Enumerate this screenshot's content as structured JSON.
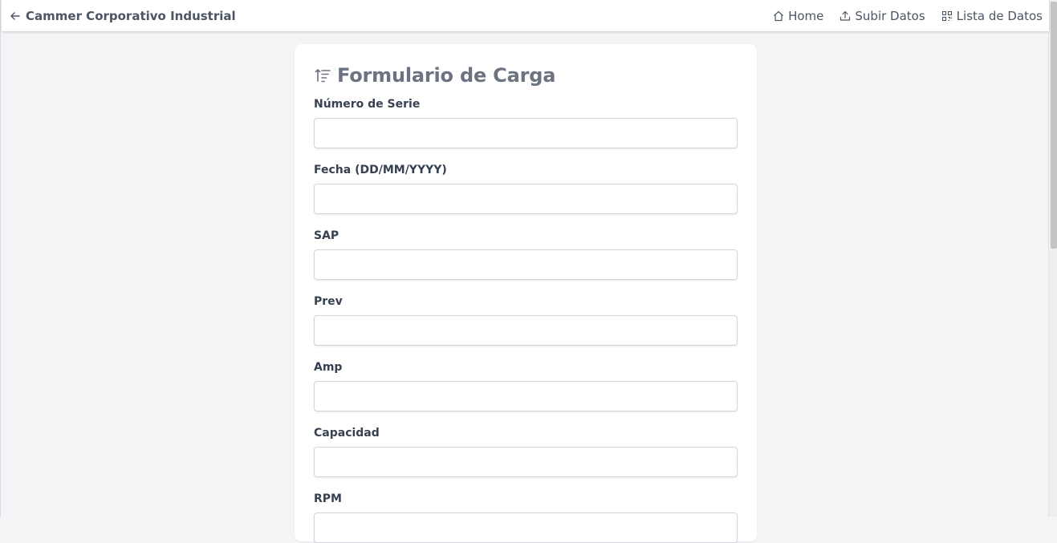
{
  "brand": {
    "icon": "arrow-left-icon",
    "title": "Cammer Corporativo Industrial"
  },
  "nav": {
    "home": {
      "icon": "home-icon",
      "label": "Home"
    },
    "upload": {
      "icon": "upload-icon",
      "label": "Subir Datos"
    },
    "list": {
      "icon": "qr-grid-icon",
      "label": "Lista de Datos"
    }
  },
  "form": {
    "icon": "sort-ascending-icon",
    "title": "Formulario de Carga",
    "fields": [
      {
        "label": "Número de Serie",
        "value": "",
        "placeholder": ""
      },
      {
        "label": "Fecha (DD/MM/YYYY)",
        "value": "",
        "placeholder": ""
      },
      {
        "label": "SAP",
        "value": "",
        "placeholder": ""
      },
      {
        "label": "Prev",
        "value": "",
        "placeholder": ""
      },
      {
        "label": "Amp",
        "value": "",
        "placeholder": ""
      },
      {
        "label": "Capacidad",
        "value": "",
        "placeholder": ""
      },
      {
        "label": "RPM",
        "value": "",
        "placeholder": ""
      }
    ]
  },
  "colors": {
    "background": "#f3f4f6",
    "card": "#ffffff",
    "text": "#374151",
    "muted": "#6b7280"
  }
}
